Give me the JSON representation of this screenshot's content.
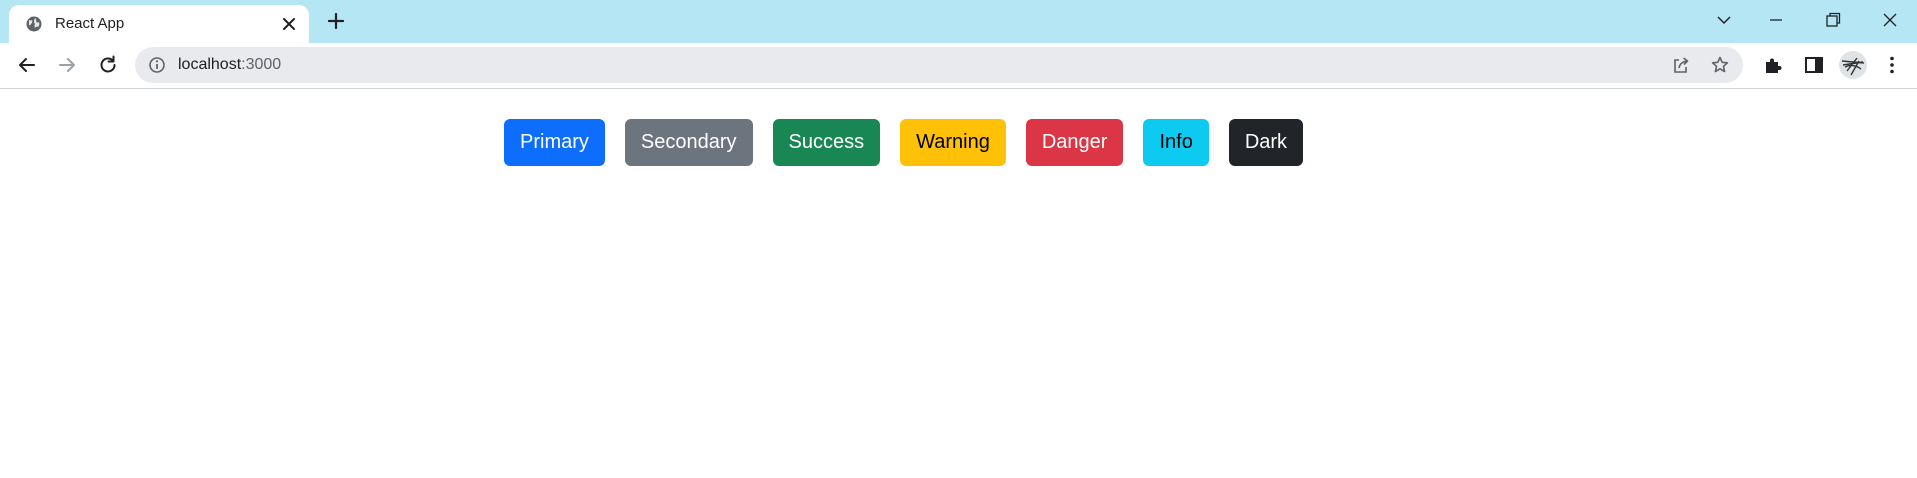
{
  "browser": {
    "tab": {
      "title": "React App"
    },
    "address_bar": {
      "host": "localhost",
      "port": ":3000"
    }
  },
  "icons": {
    "tab_favicon": "globe-icon",
    "tab_close": "close-icon",
    "new_tab": "plus-icon",
    "tab_search": "chevron-down-icon",
    "minimize": "minimize-icon",
    "restore": "restore-icon",
    "close_window": "close-icon",
    "back": "back-arrow-icon",
    "forward": "forward-arrow-icon",
    "reload": "reload-icon",
    "site_info": "info-icon",
    "share": "share-icon",
    "bookmark": "star-icon",
    "extensions": "puzzle-icon",
    "side_panel": "side-panel-icon",
    "menu": "kebab-menu-icon"
  },
  "colors": {
    "tabstrip": "#b5e6f3",
    "primary": "#0d6efd",
    "secondary": "#6c757d",
    "success": "#198754",
    "warning": "#ffc107",
    "danger": "#dc3545",
    "info": "#0dcaf0",
    "dark": "#212529"
  },
  "buttons": [
    {
      "label": "Primary",
      "bg": "#0d6efd",
      "fg": "#ffffff"
    },
    {
      "label": "Secondary",
      "bg": "#6c757d",
      "fg": "#ffffff"
    },
    {
      "label": "Success",
      "bg": "#198754",
      "fg": "#ffffff"
    },
    {
      "label": "Warning",
      "bg": "#ffc107",
      "fg": "#000000"
    },
    {
      "label": "Danger",
      "bg": "#dc3545",
      "fg": "#ffffff"
    },
    {
      "label": "Info",
      "bg": "#0dcaf0",
      "fg": "#000000"
    },
    {
      "label": "Dark",
      "bg": "#212529",
      "fg": "#ffffff"
    }
  ]
}
